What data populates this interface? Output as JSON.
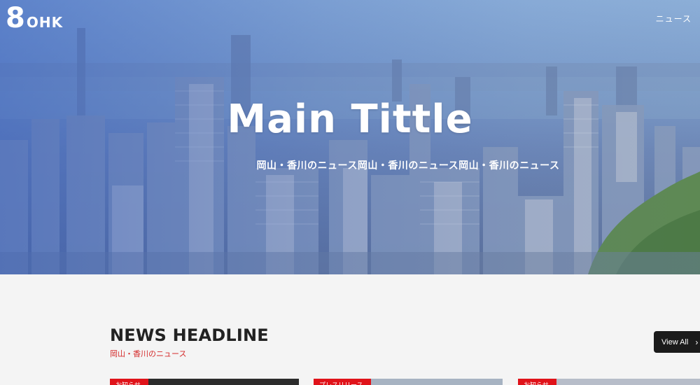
{
  "header": {
    "logo_number": "8",
    "logo_text": "OHK",
    "nav_news": "ニュース"
  },
  "hero": {
    "title": "Main Tittle",
    "subtitle": "岡山・香川のニュース岡山・香川のニュース岡山・香川のニュース"
  },
  "news": {
    "heading": "NEWS HEADLINE",
    "subheading": "岡山・香川のニュース",
    "view_all": "View All",
    "cards": [
      {
        "badge": "お知らせ"
      },
      {
        "badge": "プレスリリース"
      },
      {
        "badge": "お知らせ"
      }
    ]
  },
  "colors": {
    "accent": "#e0131a",
    "subheading": "#d42a2a",
    "button_bg": "#1b1b1b"
  }
}
